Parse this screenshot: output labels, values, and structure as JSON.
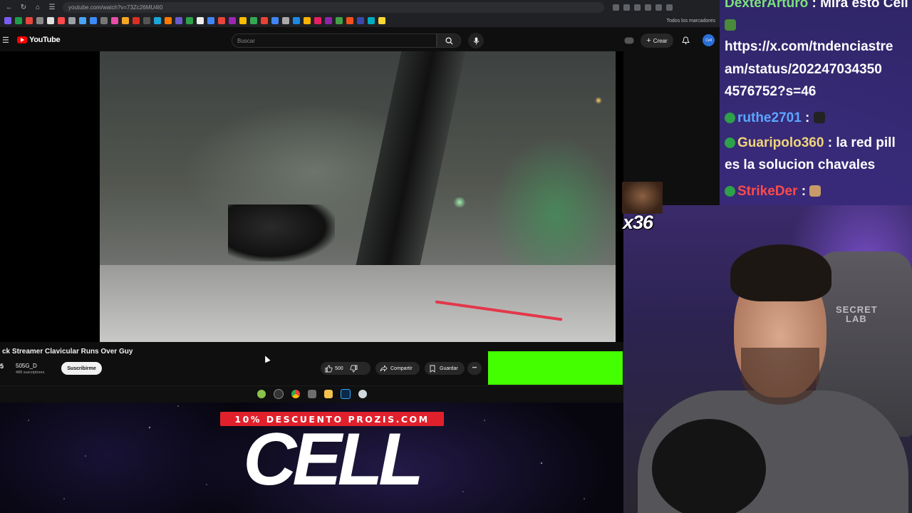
{
  "browser": {
    "url": "youtube.com/watch?v=73Zc26MU4I0",
    "bookmarks_all_label": "Todos los marcadores"
  },
  "youtube": {
    "logo_text": "YouTube",
    "search_placeholder": "Buscar",
    "create_label": "Crear",
    "avatar_text": "Cell",
    "video_title": "ck Streamer Clavicular Runs Over Guy",
    "channel_avatar_text": "5",
    "channel_name": "505G_D",
    "channel_subs": "488 suscriptores",
    "subscribe_label": "Suscribirme",
    "like_count": "500",
    "share_label": "Compartir",
    "save_label": "Guardar",
    "more_label": "•••"
  },
  "promo": {
    "discount_text": "10% DESCUENTO PROZIS.COM",
    "code_text": "CELL"
  },
  "chat": {
    "messages": [
      {
        "user": "DexterArturo",
        "text": "Mira esto Cell"
      },
      {
        "user": "",
        "text": "https://x.com/tndenciastre"
      },
      {
        "user": "",
        "text": "am/status/202247034350"
      },
      {
        "user": "",
        "text": "4576752?s=46"
      },
      {
        "user": "ruthe2701",
        "text": ""
      },
      {
        "user": "Guaripolo360",
        "text": "la red pill"
      },
      {
        "user": "",
        "text": "es la solucion chavales"
      },
      {
        "user": "StrikeDer",
        "text": ""
      }
    ]
  },
  "overlay": {
    "emote_combo": "x36"
  },
  "webcam": {
    "chair_brand_line1": "SECRET",
    "chair_brand_line2": "LAB"
  },
  "colors": {
    "youtube_red": "#ff0000",
    "green_screen": "#44ff00",
    "promo_red": "#e0212c",
    "chat_bg": "#3c2d82",
    "sub_badge": "#2ea14a"
  }
}
